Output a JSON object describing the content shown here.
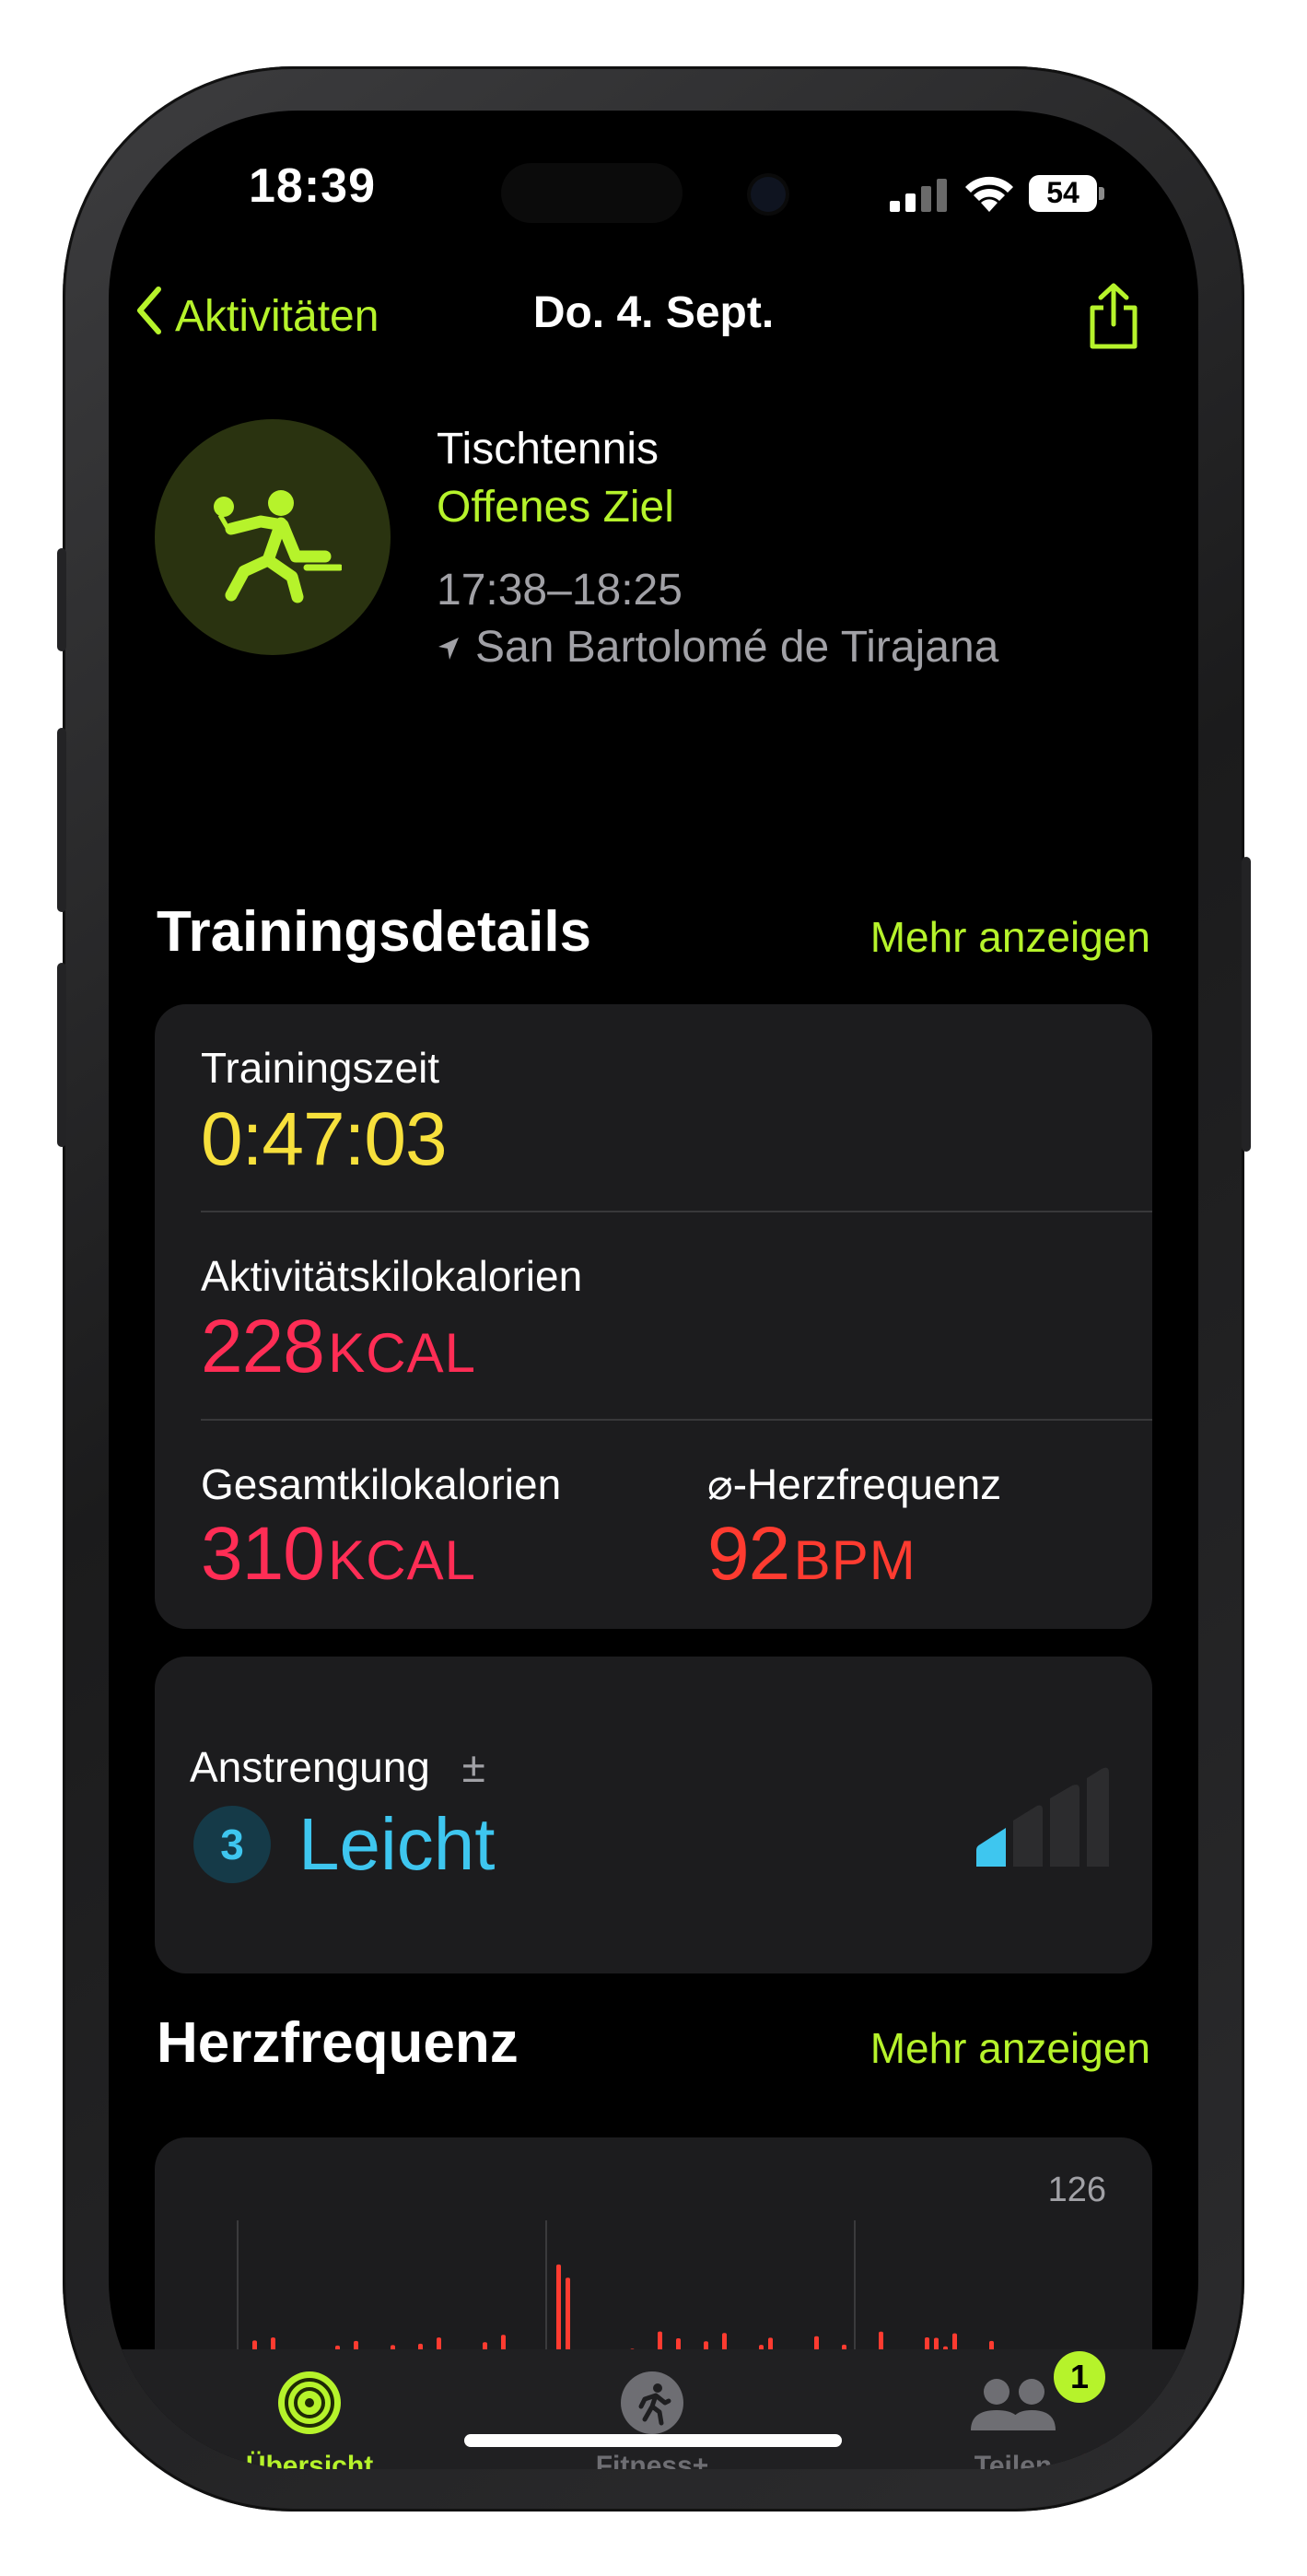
{
  "status_bar": {
    "time": "18:39",
    "battery": "54"
  },
  "nav": {
    "back_label": "Aktivitäten",
    "title": "Do. 4. Sept."
  },
  "activity": {
    "type": "Tischtennis",
    "goal": "Offenes Ziel",
    "time_range": "17:38–18:25",
    "location": "San Bartolomé de Tirajana"
  },
  "training_details": {
    "title": "Trainingsdetails",
    "more_label": "Mehr anzeigen",
    "training_time": {
      "label": "Trainingszeit",
      "value": "0:47:03"
    },
    "active_kcal": {
      "label": "Aktivitätskilokalorien",
      "value": "228",
      "unit": "KCAL"
    },
    "total_kcal": {
      "label": "Gesamtkilokalorien",
      "value": "310",
      "unit": "KCAL"
    },
    "avg_hr": {
      "label": "⌀-Herzfrequenz",
      "value": "92",
      "unit": "BPM"
    }
  },
  "effort": {
    "label": "Anstrengung",
    "plus_minus": "±",
    "score": "3",
    "level": "Leicht",
    "max_score": 10
  },
  "heart_rate": {
    "title": "Herzfrequenz",
    "more_label": "Mehr anzeigen",
    "max_label": "126"
  },
  "tab_bar": {
    "tabs": [
      {
        "label": "Übersicht",
        "icon": "activity-rings-icon",
        "active": true
      },
      {
        "label": "Fitness+",
        "icon": "fitness-plus-icon",
        "active": false
      },
      {
        "label": "Teilen",
        "icon": "people-icon",
        "active": false,
        "badge": "1"
      }
    ]
  },
  "colors": {
    "accent": "#b6f32b",
    "time_yellow": "#f7e03c",
    "kcal_pink": "#ff2d55",
    "bpm_red": "#ff3b30",
    "effort_blue": "#3ec6ef",
    "background": "#000000",
    "card": "#1c1c1e"
  }
}
